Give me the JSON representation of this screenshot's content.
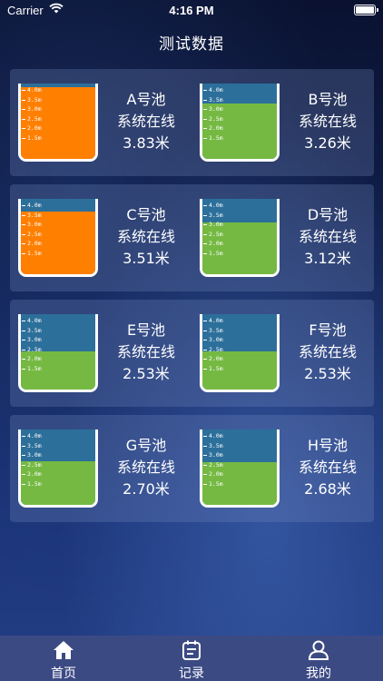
{
  "status": {
    "carrier": "Carrier",
    "time": "4:16 PM"
  },
  "title": "测试数据",
  "scale": [
    "4.0m",
    "3.5m",
    "3.0m",
    "2.5m",
    "2.0m",
    "1.5m"
  ],
  "status_text": "系统在线",
  "pools": [
    {
      "name": "A号池",
      "level": "3.83米",
      "fill_fraction": 0.95,
      "color": "#ff7f00"
    },
    {
      "name": "B号池",
      "level": "3.26米",
      "fill_fraction": 0.74,
      "color": "#75b943"
    },
    {
      "name": "C号池",
      "level": "3.51米",
      "fill_fraction": 0.83,
      "color": "#ff7f00"
    },
    {
      "name": "D号池",
      "level": "3.12米",
      "fill_fraction": 0.69,
      "color": "#75b943"
    },
    {
      "name": "E号池",
      "level": "2.53米",
      "fill_fraction": 0.51,
      "color": "#75b943"
    },
    {
      "name": "F号池",
      "level": "2.53米",
      "fill_fraction": 0.51,
      "color": "#75b943"
    },
    {
      "name": "G号池",
      "level": "2.70米",
      "fill_fraction": 0.58,
      "color": "#75b943"
    },
    {
      "name": "H号池",
      "level": "2.68米",
      "fill_fraction": 0.57,
      "color": "#75b943"
    }
  ],
  "tabs": [
    {
      "label": "首页",
      "icon": "home-icon"
    },
    {
      "label": "记录",
      "icon": "calendar-icon"
    },
    {
      "label": "我的",
      "icon": "user-icon"
    }
  ]
}
